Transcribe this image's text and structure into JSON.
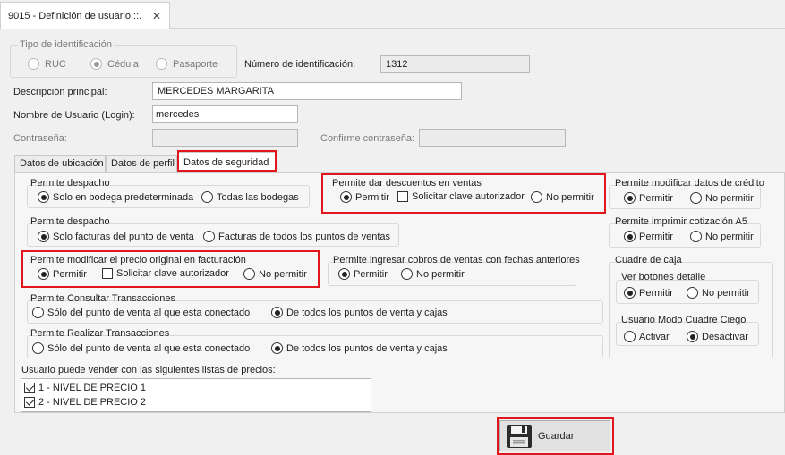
{
  "window": {
    "tab_title": "9015 - Definición de usuario ::.",
    "close_glyph": "✕"
  },
  "identification": {
    "group_title": "Tipo de identificación",
    "options": [
      "RUC",
      "Cédula",
      "Pasaporte"
    ],
    "selected": "Cédula",
    "number_label": "Número de identificación:",
    "number_value": "1312"
  },
  "fields": {
    "description_label": "Descripción principal:",
    "description_value": "MERCEDES MARGARITA",
    "username_label": "Nombre de Usuario (Login):",
    "username_value": "mercedes",
    "password_label": "Contraseña:",
    "password_value": "",
    "confirm_label": "Confirme contraseña:",
    "confirm_value": ""
  },
  "tabs": [
    "Datos de ubicación",
    "Datos de perfil",
    "Datos de seguridad"
  ],
  "active_tab": "Datos de seguridad",
  "security": {
    "dispatch1": {
      "title": "Permite despacho",
      "options": [
        "Solo en bodega predeterminada",
        "Todas las bodegas"
      ],
      "selected": 0
    },
    "discounts": {
      "title": "Permite dar descuentos en ventas",
      "permitir": "Permitir",
      "clave": "Solicitar clave autorizador",
      "no_permitir": "No permitir",
      "selected": "Permitir",
      "clave_checked": false
    },
    "credit": {
      "title": "Permite modificar datos de crédito",
      "options": [
        "Permitir",
        "No permitir"
      ],
      "selected": 0
    },
    "dispatch2": {
      "title": "Permite despacho",
      "options": [
        "Solo facturas del punto de venta",
        "Facturas de todos los puntos de ventas"
      ],
      "selected": 0
    },
    "print_a5": {
      "title": "Permite imprimir cotización A5",
      "options": [
        "Permitir",
        "No permitir"
      ],
      "selected": 0
    },
    "price": {
      "title": "Permite modificar el precio original en facturación",
      "permitir": "Permitir",
      "clave": "Solicitar clave autorizador",
      "no_permitir": "No permitir",
      "selected": "Permitir",
      "clave_checked": false
    },
    "old_dates": {
      "title": "Permite ingresar cobros de ventas con fechas anteriores",
      "options": [
        "Permitir",
        "No permitir"
      ],
      "selected": 0
    },
    "cash": {
      "title": "Cuadre de caja",
      "buttons_detail": {
        "title": "Ver botones detalle",
        "options": [
          "Permitir",
          "No permitir"
        ],
        "selected": 0
      },
      "blind_mode": {
        "title": "Usuario Modo Cuadre Ciego",
        "options": [
          "Activar",
          "Desactivar"
        ],
        "selected": 1
      }
    },
    "consult": {
      "title": "Permite Consultar Transacciones",
      "options": [
        "Sólo del punto de venta al que esta conectado",
        "De todos los puntos de venta y cajas"
      ],
      "selected": 1
    },
    "perform": {
      "title": "Permite Realizar Transacciones",
      "options": [
        "Sólo del punto de venta al que esta conectado",
        "De todos los puntos de venta y cajas"
      ],
      "selected": 1
    },
    "price_lists": {
      "label": "Usuario puede vender con las siguientes listas de precios:",
      "items": [
        {
          "label": "1 - NIVEL DE PRECIO 1",
          "checked": true
        },
        {
          "label": "2 - NIVEL DE PRECIO 2",
          "checked": true
        }
      ]
    }
  },
  "save_button": {
    "label": "Guardar",
    "icon": "floppy-disk-icon"
  },
  "colors": {
    "highlight": "#e0161c"
  }
}
